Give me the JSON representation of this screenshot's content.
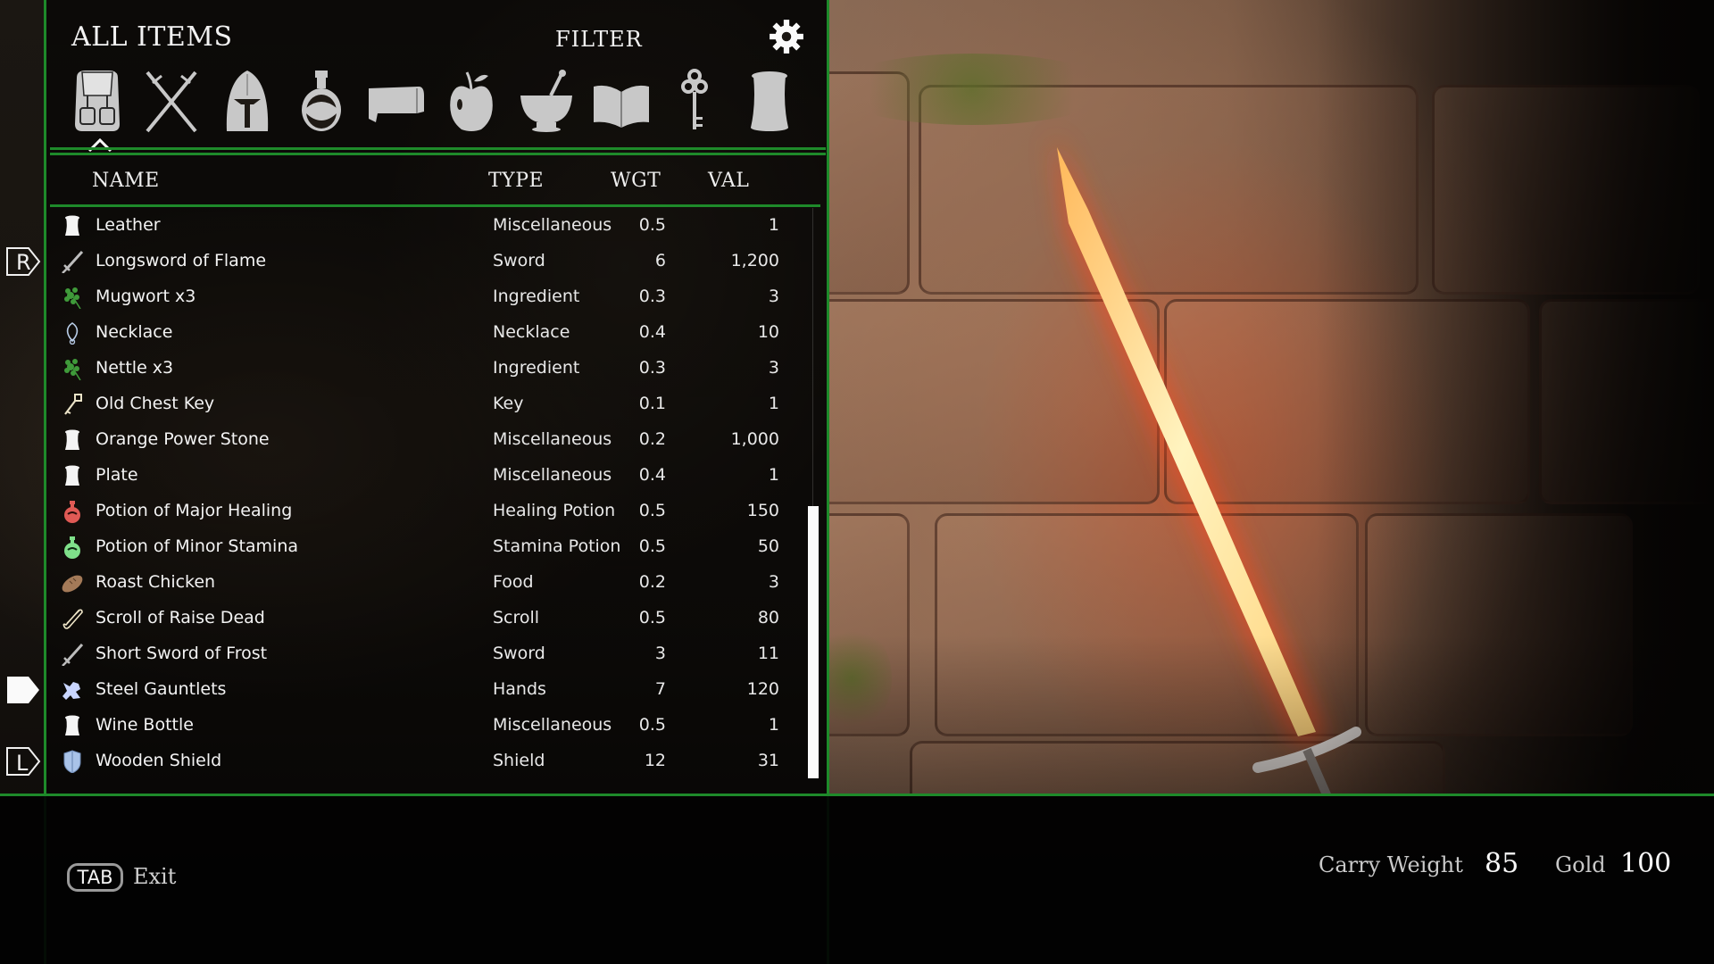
{
  "header": {
    "title": "ALL ITEMS",
    "filter_label": "FILTER",
    "settings_icon": "gear-icon"
  },
  "categories": [
    {
      "name": "all-items",
      "icon": "backpack-icon",
      "selected": true
    },
    {
      "name": "weapons",
      "icon": "crossed-swords-icon",
      "selected": false
    },
    {
      "name": "apparel",
      "icon": "helmet-icon",
      "selected": false
    },
    {
      "name": "potions",
      "icon": "potion-icon",
      "selected": false
    },
    {
      "name": "scrolls",
      "icon": "scroll-icon",
      "selected": false
    },
    {
      "name": "food",
      "icon": "apple-icon",
      "selected": false
    },
    {
      "name": "ingredients",
      "icon": "mortar-pestle-icon",
      "selected": false
    },
    {
      "name": "books",
      "icon": "book-icon",
      "selected": false
    },
    {
      "name": "keys",
      "icon": "key-icon",
      "selected": false
    },
    {
      "name": "misc",
      "icon": "misc-jar-icon",
      "selected": false
    }
  ],
  "columns": {
    "name": "NAME",
    "type": "TYPE",
    "weight": "WGT",
    "value": "VAL"
  },
  "items": [
    {
      "name": "Leather",
      "type": "Miscellaneous",
      "weight": "0.5",
      "value": "1",
      "icon": "misc-icon"
    },
    {
      "name": "Longsword of Flame",
      "type": "Sword",
      "weight": "6",
      "value": "1,200",
      "icon": "sword-icon"
    },
    {
      "name": "Mugwort x3",
      "type": "Ingredient",
      "weight": "0.3",
      "value": "3",
      "icon": "herb-icon"
    },
    {
      "name": "Necklace",
      "type": "Necklace",
      "weight": "0.4",
      "value": "10",
      "icon": "necklace-icon"
    },
    {
      "name": "Nettle x3",
      "type": "Ingredient",
      "weight": "0.3",
      "value": "3",
      "icon": "herb-icon"
    },
    {
      "name": "Old Chest Key",
      "type": "Key",
      "weight": "0.1",
      "value": "1",
      "icon": "key-icon"
    },
    {
      "name": "Orange Power Stone",
      "type": "Miscellaneous",
      "weight": "0.2",
      "value": "1,000",
      "icon": "misc-icon"
    },
    {
      "name": "Plate",
      "type": "Miscellaneous",
      "weight": "0.4",
      "value": "1",
      "icon": "misc-icon"
    },
    {
      "name": "Potion of Major Healing",
      "type": "Healing Potion",
      "weight": "0.5",
      "value": "150",
      "icon": "health-potion-icon"
    },
    {
      "name": "Potion of Minor Stamina",
      "type": "Stamina Potion",
      "weight": "0.5",
      "value": "50",
      "icon": "stamina-potion-icon"
    },
    {
      "name": "Roast Chicken",
      "type": "Food",
      "weight": "0.2",
      "value": "3",
      "icon": "food-icon"
    },
    {
      "name": "Scroll of Raise Dead",
      "type": "Scroll",
      "weight": "0.5",
      "value": "80",
      "icon": "scroll-icon"
    },
    {
      "name": "Short Sword of Frost",
      "type": "Sword",
      "weight": "3",
      "value": "11",
      "icon": "sword-icon"
    },
    {
      "name": "Steel Gauntlets",
      "type": "Hands",
      "weight": "7",
      "value": "120",
      "icon": "gauntlets-icon"
    },
    {
      "name": "Wine Bottle",
      "type": "Miscellaneous",
      "weight": "0.5",
      "value": "1",
      "icon": "misc-icon"
    },
    {
      "name": "Wooden Shield",
      "type": "Shield",
      "weight": "12",
      "value": "31",
      "icon": "shield-icon"
    }
  ],
  "side_buttons": {
    "r_label": "R",
    "l_label": "L"
  },
  "footer": {
    "tab_key": "TAB",
    "exit_label": "Exit",
    "carry_weight_label": "Carry Weight",
    "carry_weight_value": "85",
    "gold_label": "Gold",
    "gold_value": "100"
  },
  "colors": {
    "accent_green": "#1e8a2a",
    "herb_green": "#3f9a3a",
    "health_red": "#e05a55",
    "stamina_green": "#7fe08a",
    "food_brown": "#a47a58",
    "gauntlet_blue": "#c9d6ff",
    "shield_blue": "#a9c3e8"
  }
}
